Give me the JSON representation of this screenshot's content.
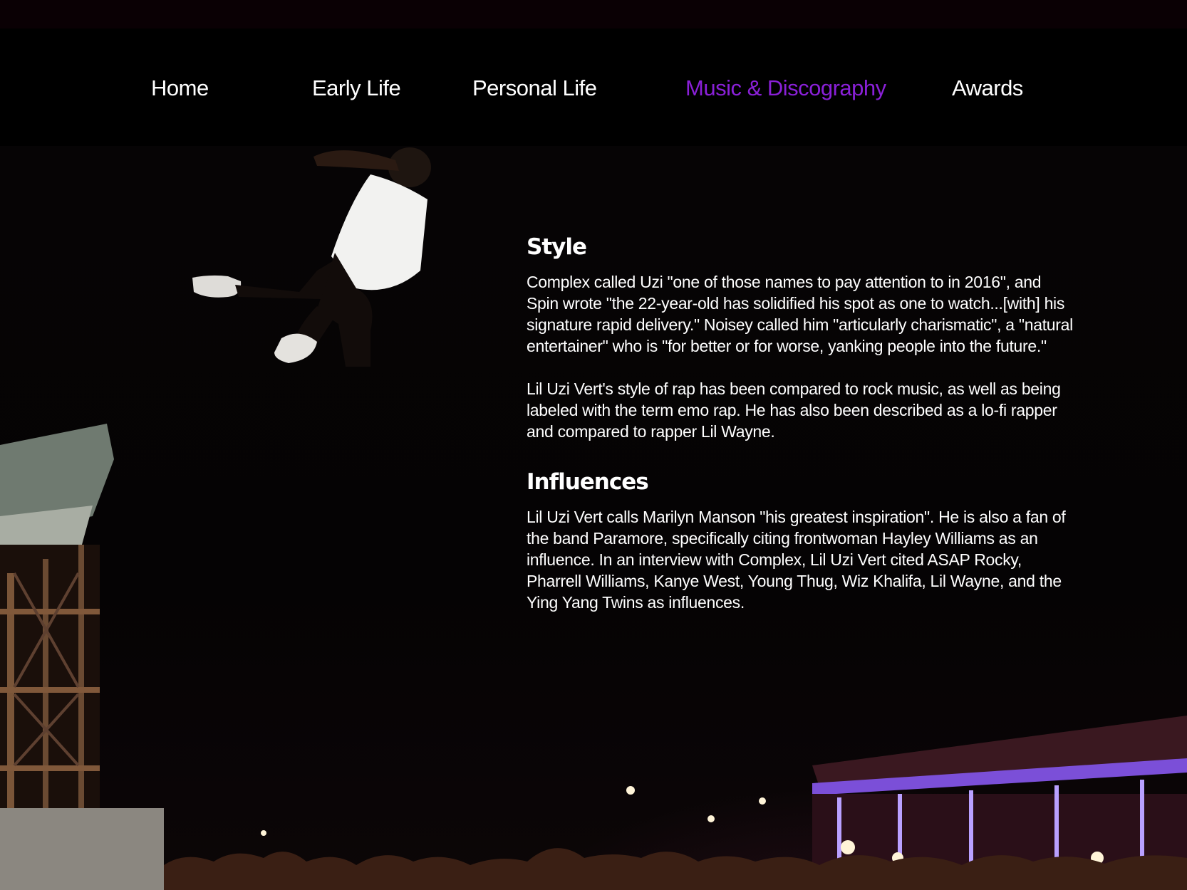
{
  "nav": {
    "items": [
      {
        "label": "Home",
        "active": false
      },
      {
        "label": "Early Life",
        "active": false
      },
      {
        "label": "Personal Life",
        "active": false
      },
      {
        "label": "Music & Discography",
        "active": true
      },
      {
        "label": "Awards",
        "active": false
      }
    ],
    "active_color": "#8a20d8"
  },
  "sections": {
    "style": {
      "heading": "Style",
      "paragraphs": [
        "Complex called Uzi \"one of those names to pay attention to in 2016\", and Spin wrote \"the 22-year-old has solidified his spot as one to watch...[with] his signature rapid delivery.\" Noisey called him \"articularly charismatic\", a \"natural entertainer\" who is \"for better or for worse, yanking people into the future.\"",
        "Lil Uzi Vert's style of rap has been compared to rock music, as well as being labeled with the term emo rap. He has also been described as a lo-fi rapper and compared to rapper Lil Wayne."
      ]
    },
    "influences": {
      "heading": "Influences",
      "paragraphs": [
        "Lil Uzi Vert calls Marilyn Manson \"his greatest inspiration\". He is also a fan of the band Paramore, specifically citing frontwoman Hayley Williams as an influence. In an interview with Complex, Lil Uzi Vert cited ASAP Rocky, Pharrell Williams, Kanye West, Young Thug, Wiz Khalifa, Lil Wayne, and the Ying Yang Twins as influences."
      ]
    }
  }
}
